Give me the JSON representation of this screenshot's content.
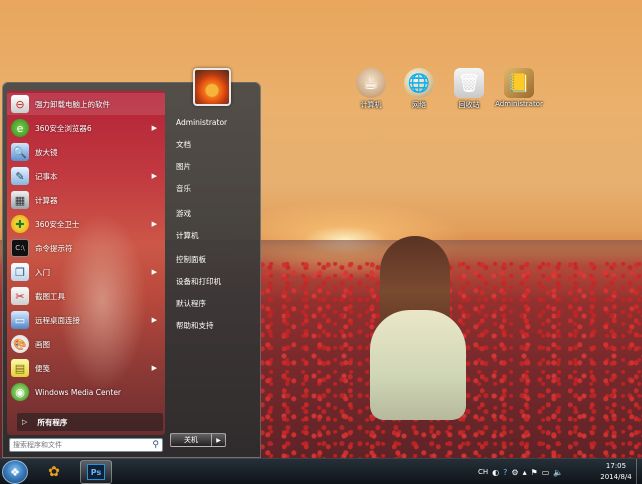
{
  "desktop": {
    "icons": [
      {
        "label": "计算机",
        "icon": "computer-icon"
      },
      {
        "label": "网络",
        "icon": "network-icon"
      },
      {
        "label": "回收站",
        "icon": "recycle-bin-icon"
      },
      {
        "label": "Administrator",
        "icon": "user-folder-icon"
      }
    ]
  },
  "start_menu": {
    "programs": [
      {
        "label": "强力卸载电脑上的软件",
        "icon": "uninstall-icon",
        "has_submenu": false
      },
      {
        "label": "360安全浏览器6",
        "icon": "browser-360-icon",
        "has_submenu": true
      },
      {
        "label": "放大镜",
        "icon": "magnifier-icon",
        "has_submenu": false
      },
      {
        "label": "记事本",
        "icon": "notepad-icon",
        "has_submenu": true
      },
      {
        "label": "计算器",
        "icon": "calculator-icon",
        "has_submenu": false
      },
      {
        "label": "360安全卫士",
        "icon": "security-360-icon",
        "has_submenu": true
      },
      {
        "label": "命令提示符",
        "icon": "cmd-icon",
        "has_submenu": false
      },
      {
        "label": "入门",
        "icon": "getting-started-icon",
        "has_submenu": true
      },
      {
        "label": "截图工具",
        "icon": "snipping-tool-icon",
        "has_submenu": false
      },
      {
        "label": "远程桌面连接",
        "icon": "remote-desktop-icon",
        "has_submenu": true
      },
      {
        "label": "画图",
        "icon": "paint-icon",
        "has_submenu": false
      },
      {
        "label": "便笺",
        "icon": "sticky-notes-icon",
        "has_submenu": true
      },
      {
        "label": "Windows Media Center",
        "icon": "media-center-icon",
        "has_submenu": false
      }
    ],
    "all_programs_label": "所有程序",
    "search_placeholder": "搜索程序和文件",
    "right_items": [
      "Administrator",
      "文档",
      "图片",
      "音乐",
      "游戏",
      "计算机",
      "控制面板",
      "设备和打印机",
      "默认程序",
      "帮助和支持"
    ],
    "shutdown_label": "关机"
  },
  "taskbar": {
    "pinned": [
      {
        "name": "media-player-taskbar",
        "icon": "media-player-icon"
      },
      {
        "name": "photoshop-taskbar",
        "icon": "photoshop-icon",
        "label": "Ps"
      }
    ],
    "tray": {
      "language": "CH",
      "time": "17:05",
      "date": "2014/8/4"
    }
  },
  "colors": {
    "menu_left_top": "#b32237",
    "menu_left_bottom": "#6d2e30",
    "taskbar": "#1a222b",
    "photoshop_blue": "#2f8fd8"
  }
}
